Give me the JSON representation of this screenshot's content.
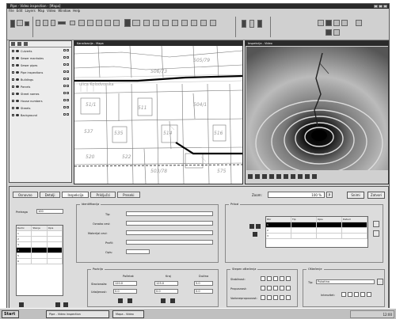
{
  "titlebar": {
    "text": "Pipe - Video inspection - [Mapa]"
  },
  "menu": {
    "items": [
      "File",
      "Edit",
      "Layers",
      "Map",
      "Video",
      "Window",
      "Help"
    ]
  },
  "layers": {
    "items": [
      {
        "label": "Culverts"
      },
      {
        "label": "Sewer manholes"
      },
      {
        "label": "Sewer pipes"
      },
      {
        "label": "Pipe inspections"
      },
      {
        "label": "Buildings"
      },
      {
        "label": "Parcels"
      },
      {
        "label": "Street names"
      },
      {
        "label": "House numbers"
      },
      {
        "label": "Streets"
      },
      {
        "label": "Background"
      }
    ]
  },
  "map_window": {
    "title": "Kanalizacija - Mapa",
    "parcels": [
      "505/79",
      "506/73",
      "51/1",
      "504/1",
      "537",
      "511",
      "535",
      "514",
      "516",
      "520",
      "522",
      "503/78",
      "575"
    ],
    "street_label": "ulica Kolodvorska"
  },
  "video_window": {
    "title": "Inspekcija - Video"
  },
  "bottom": {
    "tabs": [
      "Osnovno",
      "Detalji",
      "Inspekcija",
      "Priključci",
      "Preseki"
    ],
    "active_tab": "Inspekcija",
    "zoom_label": "Zoom:",
    "zoom_value": "100 %",
    "zoom_button": "P",
    "buttons": {
      "save": "Snimi",
      "close": "Zatvori"
    },
    "left_list": {
      "label": "Pretraga",
      "value": "100",
      "headers": [
        "Redni",
        "Stanje",
        "Opis"
      ],
      "rows": [
        {
          "c1": "1",
          "c2": "",
          "c3": ""
        },
        {
          "c1": "2",
          "c2": "",
          "c3": ""
        },
        {
          "c1": "3",
          "c2": "",
          "c3": ""
        },
        {
          "c1": "4",
          "c2": "",
          "c3": ""
        },
        {
          "c1": "5",
          "c2": "",
          "c3": ""
        },
        {
          "c1": "6",
          "c2": "",
          "c3": ""
        }
      ]
    },
    "form": {
      "title": "Identifikacija",
      "fields": [
        {
          "label": "Tip:",
          "value": ""
        },
        {
          "label": "Oznaka cevi:",
          "value": ""
        },
        {
          "label": "Materijal cevi:",
          "value": ""
        },
        {
          "label": "Profil:",
          "value": ""
        },
        {
          "label": "Opis:",
          "value": ""
        }
      ]
    },
    "attachments": {
      "title": "Prilozi",
      "headers": [
        "Rbr",
        "Tip",
        "Opis",
        "Datum"
      ],
      "rows": [
        {
          "c1": "1",
          "c2": "",
          "c3": "",
          "c4": ""
        },
        {
          "c1": "2",
          "c2": "",
          "c3": "",
          "c4": ""
        },
        {
          "c1": "3",
          "c2": "",
          "c3": "",
          "c4": ""
        }
      ]
    },
    "position": {
      "title": "Pozicija",
      "col_headers": [
        "Početak",
        "Kraj",
        "Dužina"
      ],
      "rows": [
        {
          "label": "Stacionaža:",
          "start": "120.0",
          "end": "125.0",
          "length": "5.0"
        },
        {
          "label": "Udaljenost:",
          "start": "0.0",
          "end": "0.0",
          "length": "0.0"
        }
      ]
    },
    "condition": {
      "title": "Stepen oštećenja",
      "rows": [
        {
          "label": "Stabilnost:",
          "options": [
            "1",
            "2",
            "3",
            "4",
            "5"
          ]
        },
        {
          "label": "Propusnost:",
          "options": [
            "1",
            "2",
            "3",
            "4",
            "5"
          ]
        },
        {
          "label": "Vodonepropusnost:",
          "options": [
            "1",
            "2",
            "3",
            "4",
            "5"
          ]
        }
      ]
    },
    "damage": {
      "title": "Oštećenje",
      "type_label": "Tip:",
      "type_value": "Pukotina",
      "severity_label": "Intenzitet:",
      "severity_options": [
        "1",
        "2",
        "3",
        "4",
        "5"
      ]
    }
  },
  "taskbar": {
    "start_label": "Start",
    "tasks": [
      "Pipe - Video inspection",
      "Mapa - Video"
    ],
    "clock": "12:00"
  }
}
